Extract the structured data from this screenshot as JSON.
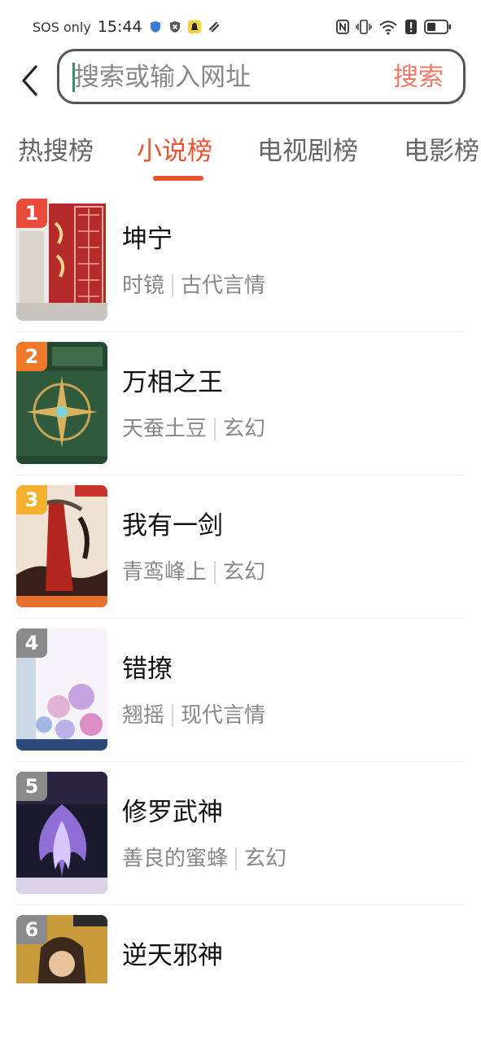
{
  "status_bar": {
    "carrier": "SOS only",
    "time": "15:44"
  },
  "search": {
    "placeholder": "搜索或输入网址",
    "button_label": "搜索"
  },
  "tabs": [
    {
      "label": "热搜榜"
    },
    {
      "label": "小说榜"
    },
    {
      "label": "电视剧榜"
    },
    {
      "label": "电影榜"
    }
  ],
  "active_tab": "小说榜",
  "colors": {
    "accent": "#e8542f",
    "rank_1": "#e84b3a",
    "rank_2": "#ef7a2c",
    "rank_3": "#f3b12f",
    "rank_other": "#8a8a8a"
  },
  "books": [
    {
      "rank": "1",
      "title": "坤宁",
      "author": "时镜",
      "genre": "古代言情"
    },
    {
      "rank": "2",
      "title": "万相之王",
      "author": "天蚕土豆",
      "genre": "玄幻"
    },
    {
      "rank": "3",
      "title": "我有一剑",
      "author": "青鸾峰上",
      "genre": "玄幻"
    },
    {
      "rank": "4",
      "title": "错撩",
      "author": "翘摇",
      "genre": "现代言情"
    },
    {
      "rank": "5",
      "title": "修罗武神",
      "author": "善良的蜜蜂",
      "genre": "玄幻"
    },
    {
      "rank": "6",
      "title": "逆天邪神",
      "author": "",
      "genre": ""
    }
  ]
}
